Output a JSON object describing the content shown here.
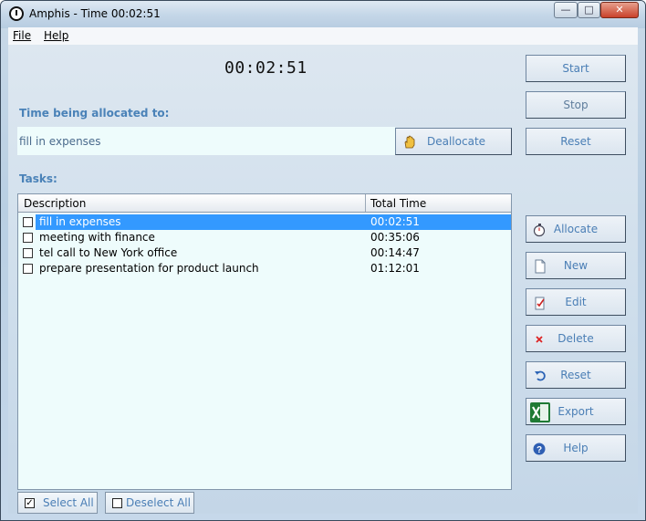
{
  "window": {
    "title": "Amphis - Time 00:02:51",
    "minimize_glyph": "—",
    "maximize_glyph": "□",
    "close_glyph": "✕"
  },
  "menu": {
    "file": "File",
    "help": "Help"
  },
  "timer": "00:02:51",
  "allocation": {
    "heading": "Time being allocated to:",
    "current_task": "fill in expenses",
    "deallocate_label": "Deallocate"
  },
  "controls": {
    "start": "Start",
    "stop": "Stop",
    "reset": "Reset"
  },
  "tasks": {
    "heading": "Tasks:",
    "columns": {
      "description": "Description",
      "total_time": "Total Time"
    },
    "rows": [
      {
        "description": "fill in expenses",
        "total_time": "00:02:51",
        "checked": false,
        "selected": true
      },
      {
        "description": "meeting with finance",
        "total_time": "00:35:06",
        "checked": false,
        "selected": false
      },
      {
        "description": "tel call to New York office",
        "total_time": "00:14:47",
        "checked": false,
        "selected": false
      },
      {
        "description": "prepare presentation for product launch",
        "total_time": "01:12:01",
        "checked": false,
        "selected": false
      }
    ]
  },
  "actions": {
    "allocate": "Allocate",
    "new": "New",
    "edit": "Edit",
    "delete": "Delete",
    "reset": "Reset",
    "export": "Export",
    "help": "Help"
  },
  "selection": {
    "select_all": "Select All",
    "deselect_all": "Deselect All"
  },
  "colors": {
    "accent": "#4a82b8",
    "selection": "#3399ff",
    "list_background": "#eefcfc"
  }
}
